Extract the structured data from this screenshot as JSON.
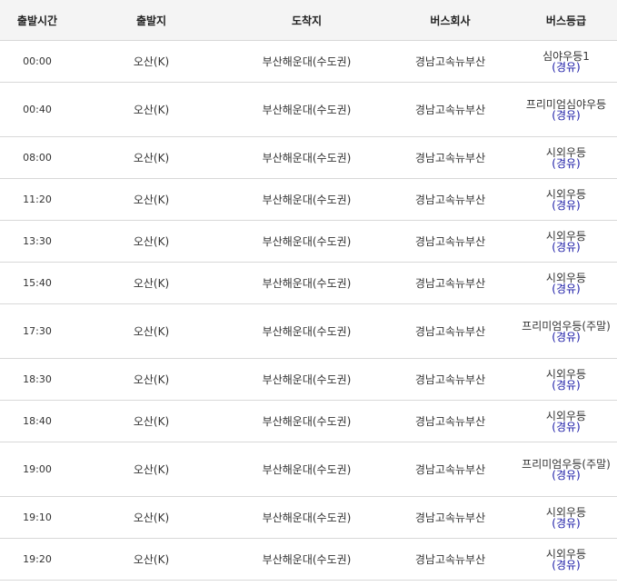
{
  "headers": [
    "출발시간",
    "출발지",
    "도착지",
    "버스회사",
    "버스등급"
  ],
  "rows": [
    {
      "time": "00:00",
      "origin": "오산(K)",
      "dest": "부산해운대(수도권)",
      "company": "경남고속뉴부산",
      "grade": "심야우등1",
      "fuel": "(경유)"
    },
    {
      "time": "00:40",
      "origin": "오산(K)",
      "dest": "부산해운대(수도권)",
      "company": "경남고속뉴부산",
      "grade": "프리미엄심야우등",
      "fuel": "(경유)"
    },
    {
      "time": "08:00",
      "origin": "오산(K)",
      "dest": "부산해운대(수도권)",
      "company": "경남고속뉴부산",
      "grade": "시외우등",
      "fuel": "(경유)"
    },
    {
      "time": "11:20",
      "origin": "오산(K)",
      "dest": "부산해운대(수도권)",
      "company": "경남고속뉴부산",
      "grade": "시외우등",
      "fuel": "(경유)"
    },
    {
      "time": "13:30",
      "origin": "오산(K)",
      "dest": "부산해운대(수도권)",
      "company": "경남고속뉴부산",
      "grade": "시외우등",
      "fuel": "(경유)"
    },
    {
      "time": "15:40",
      "origin": "오산(K)",
      "dest": "부산해운대(수도권)",
      "company": "경남고속뉴부산",
      "grade": "시외우등",
      "fuel": "(경유)"
    },
    {
      "time": "17:30",
      "origin": "오산(K)",
      "dest": "부산해운대(수도권)",
      "company": "경남고속뉴부산",
      "grade": "프리미엄우등(주말)",
      "fuel": "(경유)"
    },
    {
      "time": "18:30",
      "origin": "오산(K)",
      "dest": "부산해운대(수도권)",
      "company": "경남고속뉴부산",
      "grade": "시외우등",
      "fuel": "(경유)"
    },
    {
      "time": "18:40",
      "origin": "오산(K)",
      "dest": "부산해운대(수도권)",
      "company": "경남고속뉴부산",
      "grade": "시외우등",
      "fuel": "(경유)"
    },
    {
      "time": "19:00",
      "origin": "오산(K)",
      "dest": "부산해운대(수도권)",
      "company": "경남고속뉴부산",
      "grade": "프리미엄우등(주말)",
      "fuel": "(경유)"
    },
    {
      "time": "19:10",
      "origin": "오산(K)",
      "dest": "부산해운대(수도권)",
      "company": "경남고속뉴부산",
      "grade": "시외우등",
      "fuel": "(경유)"
    },
    {
      "time": "19:20",
      "origin": "오산(K)",
      "dest": "부산해운대(수도권)",
      "company": "경남고속뉴부산",
      "grade": "시외우등",
      "fuel": "(경유)"
    }
  ],
  "colors": {
    "header_bg": "#f4f4f4",
    "fuel_text": "#1a1aa6",
    "row_border": "#d8d8d8"
  }
}
